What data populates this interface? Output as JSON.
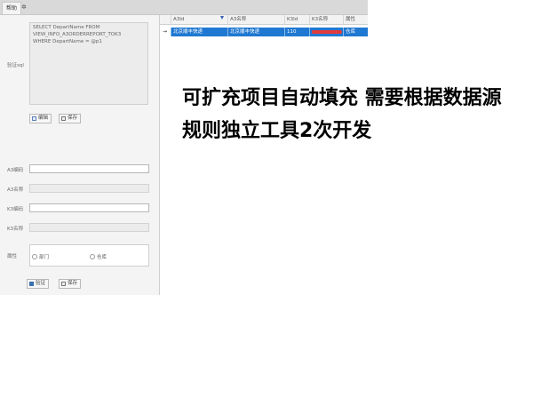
{
  "tab": {
    "title": "帮助"
  },
  "left": {
    "sql_label": "验证sql",
    "sql_lines": [
      "SELECT DepartName FROM",
      "VIEW_INFO_A3ORDERREPORT_TOK3",
      "WHERE DepartName = @p1"
    ],
    "edit_label": "编辑",
    "save_label": "保存",
    "a3_code_label": "A3编码",
    "a3_name_label": "A3名称",
    "k3_code_label": "K3编码",
    "k3_name_label": "K3名称",
    "attr_label": "属性",
    "radio_dept": "部门",
    "radio_warehouse": "仓库",
    "verify_label": "验证",
    "save2_label": "保存"
  },
  "grid": {
    "headers": [
      "A3Id",
      "A3名称",
      "K3Id",
      "K3名称",
      "属性"
    ],
    "row": {
      "indicator": "→",
      "a3id": "北京顺丰快递",
      "a3name": "北京顺丰快递",
      "k3id": "110",
      "k3name": "",
      "attr": "仓库"
    }
  },
  "overlay_text": "可扩充项目自动填充 需要根据数据源规则独立工具2次开发",
  "colors": {
    "selected_row": "#1f78d1",
    "redaction": "#e23a3a"
  }
}
